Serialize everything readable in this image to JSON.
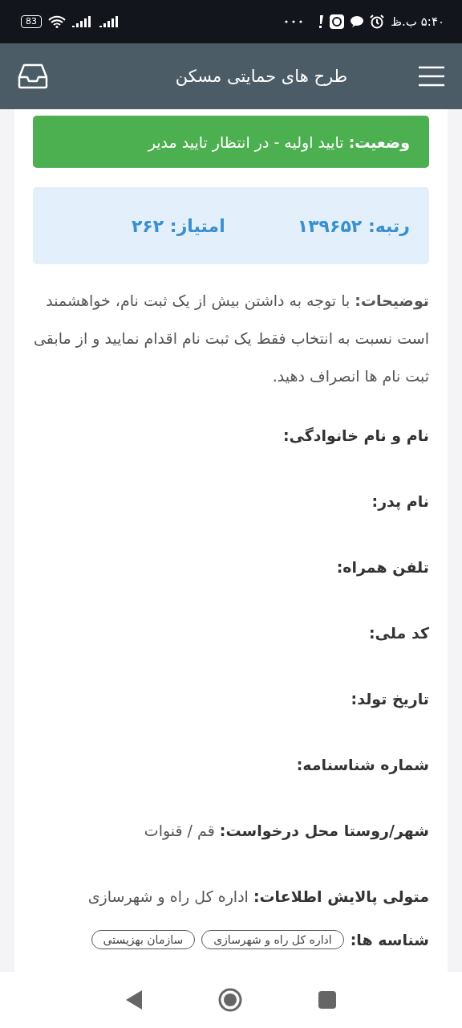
{
  "status_bar": {
    "time": "۵:۴۰ ب.ظ",
    "battery": "83"
  },
  "header": {
    "title": "طرح های حمایتی مسکن"
  },
  "status": {
    "label": "وضعیت:",
    "value": "تایید اولیه - در انتظار تایید مدیر"
  },
  "rank": {
    "rank_label": "رتبه:",
    "rank_value": "۱۳۹۶۵۲",
    "score_label": "امتیاز:",
    "score_value": "۲۶۲"
  },
  "description": "**توضیحات:** با توجه به داشتن بیش از یک ثبت نام، خواهشمند است نسبت به انتخاب فقط یک ثبت نام اقدام نمایید و از مابقی ثبت نام ها انصراف دهید.",
  "fields": [
    {
      "label": "نام و نام خانوادگی:"
    },
    {
      "label": "نام پدر:"
    },
    {
      "label": "تلفن همراه:"
    },
    {
      "label": "کد ملی:"
    },
    {
      "label": "تاریخ تولد:"
    },
    {
      "label": "شماره شناسنامه:"
    },
    {
      "label": "شهر/روستا محل درخواست:",
      "value": "قم / قنوات"
    },
    {
      "label": "متولی پالایش اطلاعات:",
      "value": "اداره کل راه و شهرسازی"
    }
  ],
  "tags": {
    "label": "شناسه ها:",
    "items": [
      "اداره کل راه و شهرسازی",
      "سازمان بهزیستی"
    ]
  }
}
